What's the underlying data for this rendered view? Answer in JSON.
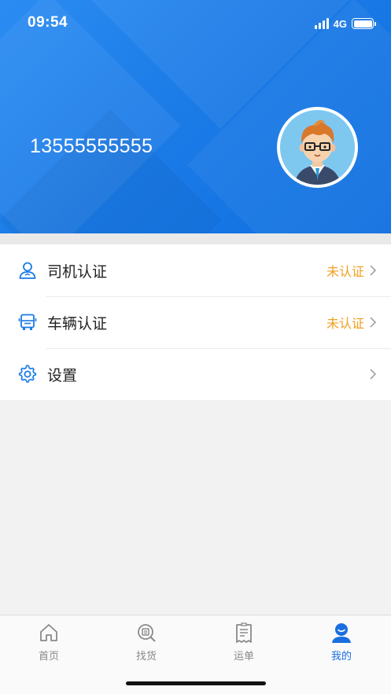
{
  "status_bar": {
    "time": "09:54",
    "network": "4G"
  },
  "header": {
    "phone": "13555555555"
  },
  "menu": {
    "items": [
      {
        "label": "司机认证",
        "status": "未认证",
        "icon": "driver-icon"
      },
      {
        "label": "车辆认证",
        "status": "未认证",
        "icon": "vehicle-icon"
      },
      {
        "label": "设置",
        "status": "",
        "icon": "gear-icon"
      }
    ]
  },
  "tabbar": {
    "tabs": [
      {
        "label": "首页",
        "icon": "home-icon"
      },
      {
        "label": "找货",
        "icon": "find-goods-icon"
      },
      {
        "label": "运单",
        "icon": "waybill-icon"
      },
      {
        "label": "我的",
        "icon": "profile-icon",
        "active": true
      }
    ]
  },
  "colors": {
    "accent": "#1a7ae6",
    "status_warning": "#f0a020",
    "active_tab": "#1a6fe0"
  }
}
